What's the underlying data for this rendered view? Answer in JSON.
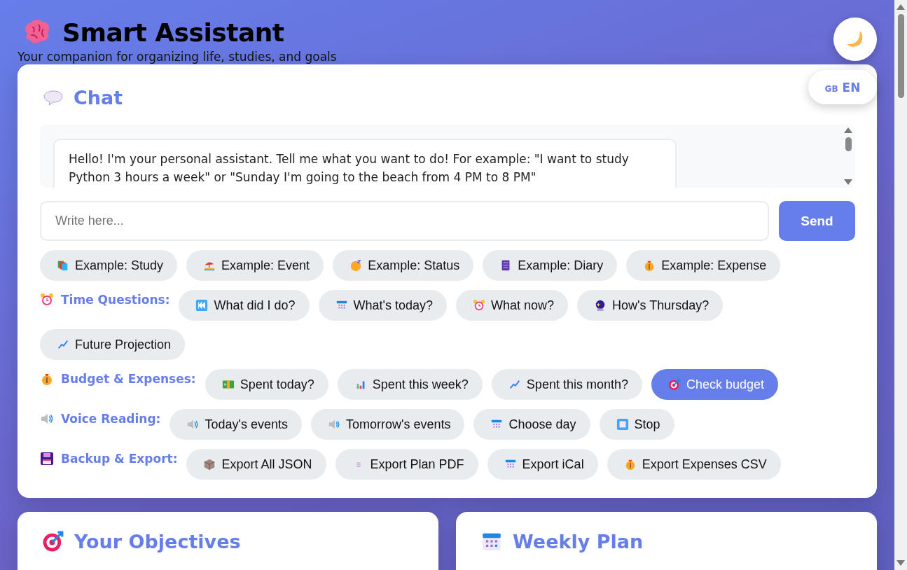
{
  "header": {
    "title": "Smart Assistant",
    "subtitle": "Your companion for organizing life, studies, and goals"
  },
  "language_button": {
    "flag": "GB",
    "code": "EN"
  },
  "chat": {
    "title": "Chat",
    "messages": [
      "Hello! I'm your personal assistant. Tell me what you want to do! For example: \"I want to study Python 3 hours a week\" or \"Sunday I'm going to the beach from 4 PM to 8 PM\""
    ],
    "input": {
      "placeholder": "Write here..."
    },
    "send_button": "Send"
  },
  "examples": [
    {
      "label": "Example: Study",
      "selected": false
    },
    {
      "label": "Example: Event",
      "selected": false
    },
    {
      "label": "Example: Status",
      "selected": false
    },
    {
      "label": "Example: Diary",
      "selected": false
    },
    {
      "label": "Example: Expense",
      "selected": false
    }
  ],
  "groups": [
    {
      "label": "Time Questions:",
      "chips": [
        {
          "label": "What did I do?",
          "selected": false
        },
        {
          "label": "What's today?",
          "selected": false
        },
        {
          "label": "What now?",
          "selected": false
        },
        {
          "label": "How's Thursday?",
          "selected": false
        },
        {
          "label": "Future Projection",
          "selected": false
        }
      ]
    },
    {
      "label": "Budget & Expenses:",
      "chips": [
        {
          "label": "Spent today?",
          "selected": false
        },
        {
          "label": "Spent this week?",
          "selected": false
        },
        {
          "label": "Spent this month?",
          "selected": false
        },
        {
          "label": "Check budget",
          "selected": true
        }
      ]
    },
    {
      "label": "Voice Reading:",
      "chips": [
        {
          "label": "Today's events",
          "selected": false
        },
        {
          "label": "Tomorrow's events",
          "selected": false
        },
        {
          "label": "Choose day",
          "selected": false
        },
        {
          "label": "Stop",
          "selected": false
        }
      ]
    },
    {
      "label": "Backup & Export:",
      "chips": [
        {
          "label": "Export All JSON",
          "selected": false
        },
        {
          "label": "Export Plan PDF",
          "selected": false
        },
        {
          "label": "Export iCal",
          "selected": false
        },
        {
          "label": "Export Expenses CSV",
          "selected": false
        }
      ]
    }
  ],
  "panels": [
    {
      "title": "Your Objectives"
    },
    {
      "title": "Weekly Plan"
    }
  ]
}
